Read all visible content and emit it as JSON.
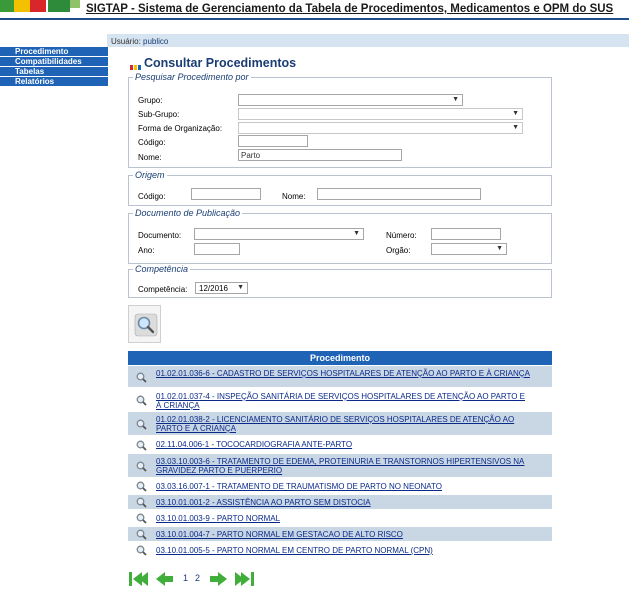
{
  "header": {
    "title": "SIGTAP - Sistema de Gerenciamento da Tabela de Procedimentos, Medicamentos e OPM do SUS"
  },
  "userbar": {
    "label": "Usuário:",
    "user": "publico"
  },
  "sidebar": {
    "items": [
      {
        "label": "Procedimento"
      },
      {
        "label": "Compatibilidades"
      },
      {
        "label": "Tabelas"
      },
      {
        "label": "Relatórios"
      }
    ]
  },
  "page": {
    "title": "Consultar Procedimentos"
  },
  "pesquisar": {
    "legend": "Pesquisar Procedimento por",
    "grupo_label": "Grupo:",
    "grupo_value": "",
    "subgrupo_label": "Sub-Grupo:",
    "subgrupo_value": "",
    "forma_label": "Forma de Organização:",
    "forma_value": "",
    "codigo_label": "Código:",
    "codigo_value": "",
    "nome_label": "Nome:",
    "nome_value": "Parto"
  },
  "origem": {
    "legend": "Origem",
    "codigo_label": "Código:",
    "codigo_value": "",
    "nome_label": "Nome:",
    "nome_value": ""
  },
  "documento": {
    "legend": "Documento de Publicação",
    "documento_label": "Documento:",
    "documento_value": "",
    "numero_label": "Número:",
    "numero_value": "",
    "ano_label": "Ano:",
    "ano_value": "",
    "orgao_label": "Orgão:",
    "orgao_value": ""
  },
  "competencia": {
    "legend": "Competência",
    "label": "Competência:",
    "value": "12/2016"
  },
  "results": {
    "header": "Procedimento",
    "rows": [
      {
        "text": "01.02.01.036-6 - CADASTRO DE SERVIÇOS HOSPITALARES DE ATENÇÃO AO PARTO E À CRIANÇA"
      },
      {
        "text": "01.02.01.037-4 - INSPEÇÃO SANITÁRIA DE SERVIÇOS HOSPITALARES DE ATENÇÃO AO PARTO E À CRIANÇA"
      },
      {
        "text": "01.02.01.038-2 - LICENCIAMENTO SANITÁRIO DE SERVIÇOS HOSPITALARES DE ATENÇÃO AO PARTO E À CRIANÇA"
      },
      {
        "text": "02.11.04.006-1 - TOCOCARDIOGRAFIA ANTE-PARTO"
      },
      {
        "text": "03.03.10.003-6 - TRATAMENTO DE EDEMA, PROTEINURIA E TRANSTORNOS HIPERTENSIVOS NA GRAVIDEZ PARTO E PUERPERIO"
      },
      {
        "text": "03.03.16.007-1 - TRATAMENTO DE TRAUMATISMO DE PARTO NO NEONATO"
      },
      {
        "text": "03.10.01.001-2 - ASSISTÊNCIA AO PARTO SEM DISTOCIA"
      },
      {
        "text": "03.10.01.003-9 - PARTO NORMAL"
      },
      {
        "text": "03.10.01.004-7 - PARTO NORMAL EM GESTACAO DE ALTO RISCO"
      },
      {
        "text": "03.10.01.005-5 - PARTO NORMAL EM CENTRO DE PARTO NORMAL (CPN)"
      }
    ]
  },
  "pager": {
    "page1": "1",
    "page2": "2"
  },
  "colors": {
    "accent": "#1e63b5",
    "row_alt": "#c9d6e4",
    "title": "#1a3d73"
  }
}
